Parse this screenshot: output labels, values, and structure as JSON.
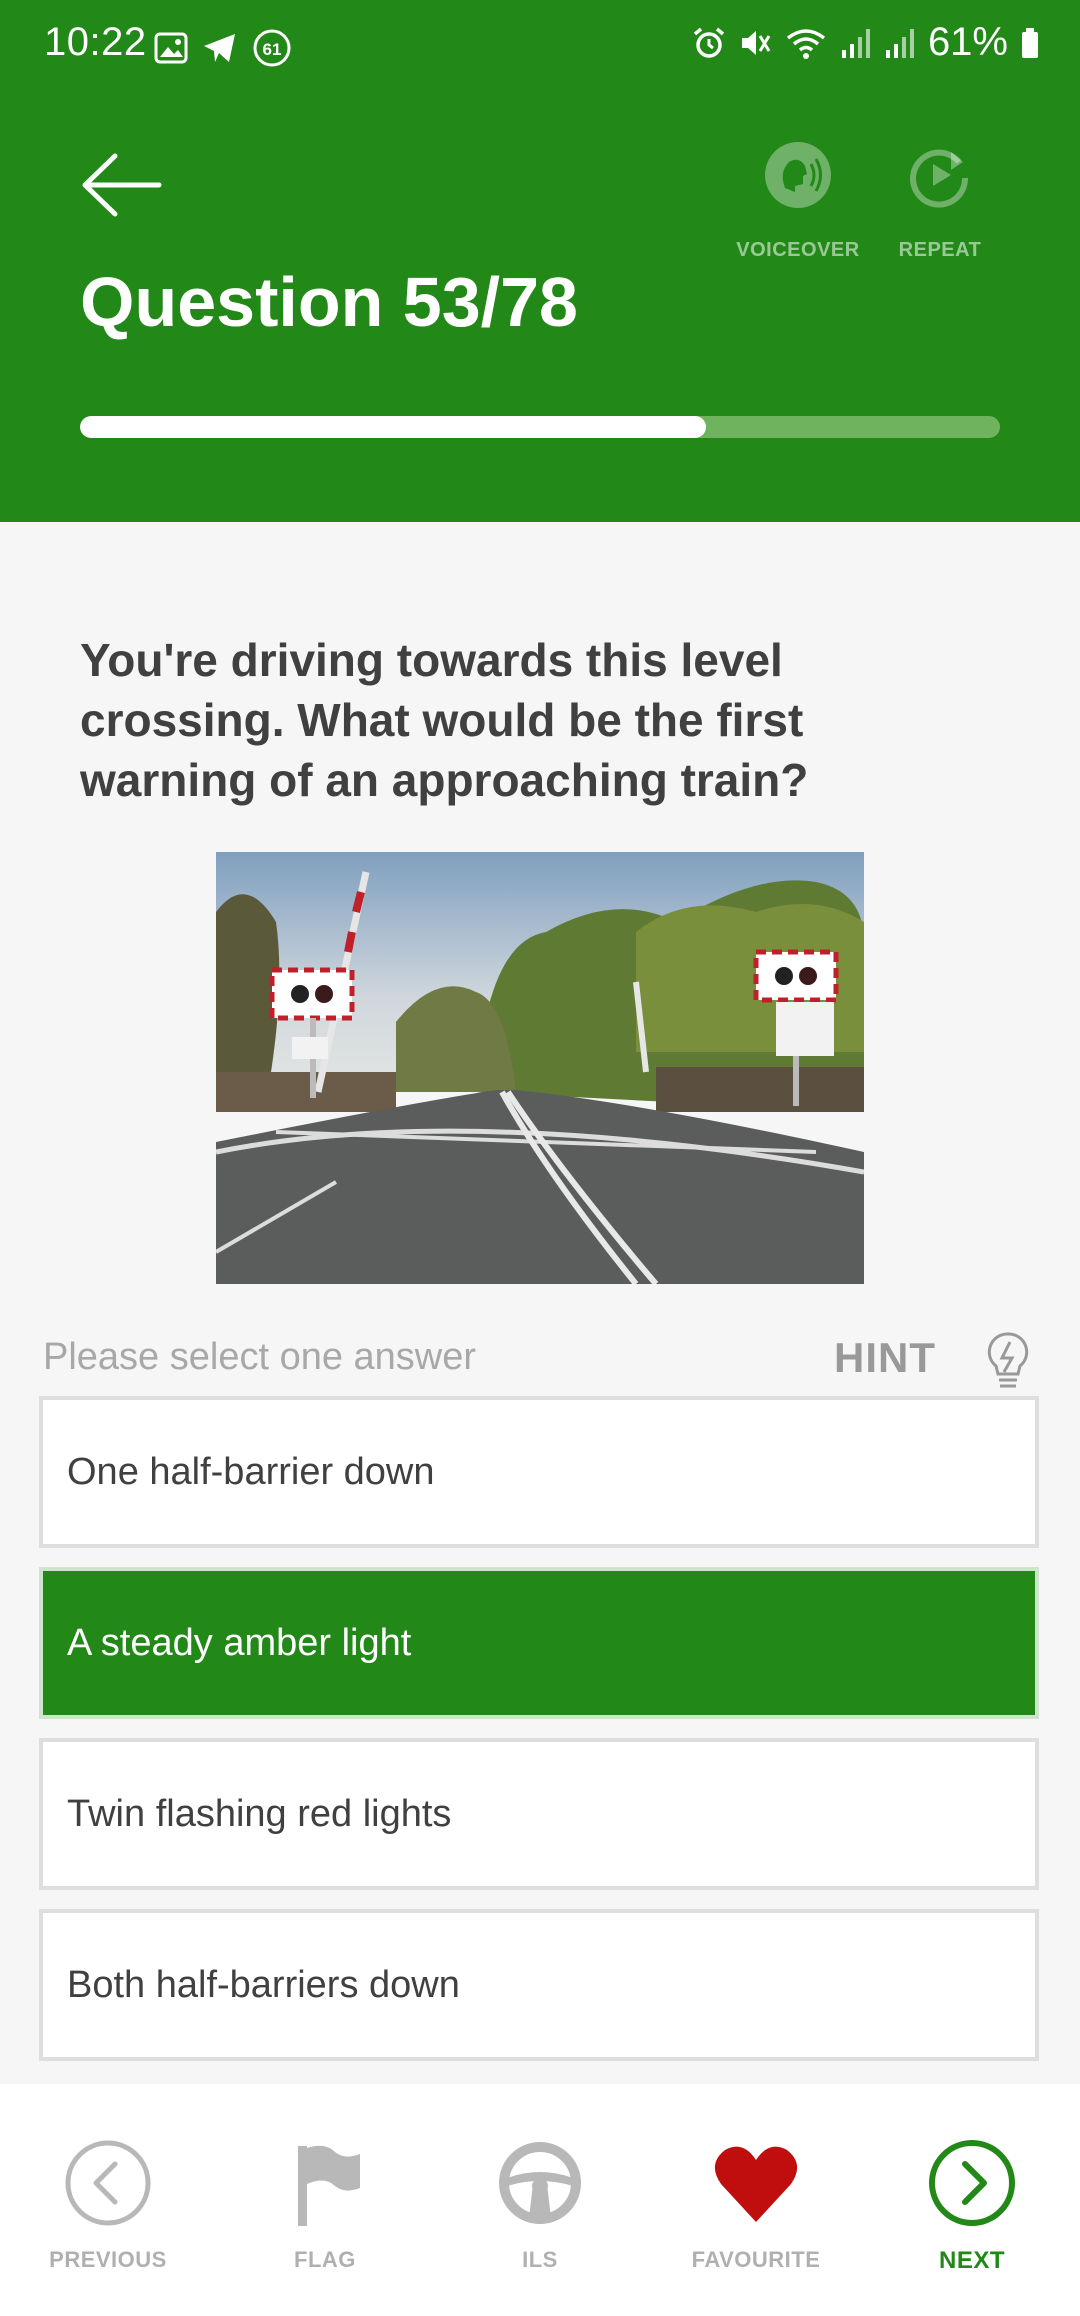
{
  "status_bar": {
    "time": "10:22",
    "notification_count": "61",
    "battery": "61%"
  },
  "header": {
    "title": "Question 53/78",
    "voiceover_label": "VOICEOVER",
    "repeat_label": "REPEAT",
    "progress_fraction": 0.68
  },
  "question": {
    "text": "You're driving towards this level crossing. What would be the first warning of an approaching train?"
  },
  "answers_section": {
    "prompt": "Please select one answer",
    "hint_label": "HINT",
    "options": [
      "One half-barrier down",
      "A steady amber light",
      "Twin flashing red lights",
      "Both half-barriers down"
    ],
    "selected_index": 1
  },
  "bottom_nav": {
    "previous": "PREVIOUS",
    "flag": "FLAG",
    "ils": "ILS",
    "favourite": "FAVOURITE",
    "next": "NEXT"
  },
  "colors": {
    "brand_green": "#228817",
    "favourite_red": "#c00d0d"
  }
}
